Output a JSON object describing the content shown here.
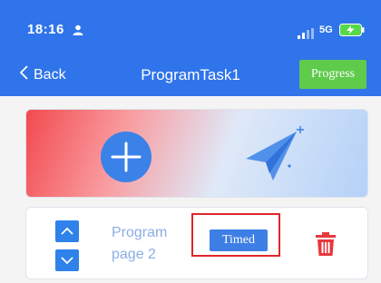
{
  "status_bar": {
    "time": "18:16",
    "network": "5G",
    "person_icon": "person-icon",
    "signal_icon": "signal-icon",
    "battery_icon": "battery-charging-icon"
  },
  "nav": {
    "back_label": "Back",
    "title": "ProgramTask1",
    "progress_label": "Progress"
  },
  "banner": {
    "add_icon": "plus-icon",
    "decoration_icon": "paper-plane-icon"
  },
  "program_row": {
    "name": "Program page 2",
    "timed_label": "Timed",
    "move_up_icon": "chevron-up-icon",
    "move_down_icon": "chevron-down-icon",
    "delete_icon": "trash-icon"
  },
  "colors": {
    "header_bg": "#2f74ea",
    "progress_button": "#5ecb4b",
    "timed_button": "#3e7fe6",
    "highlight_border": "#e1262a",
    "delete_icon": "#e5393c"
  }
}
